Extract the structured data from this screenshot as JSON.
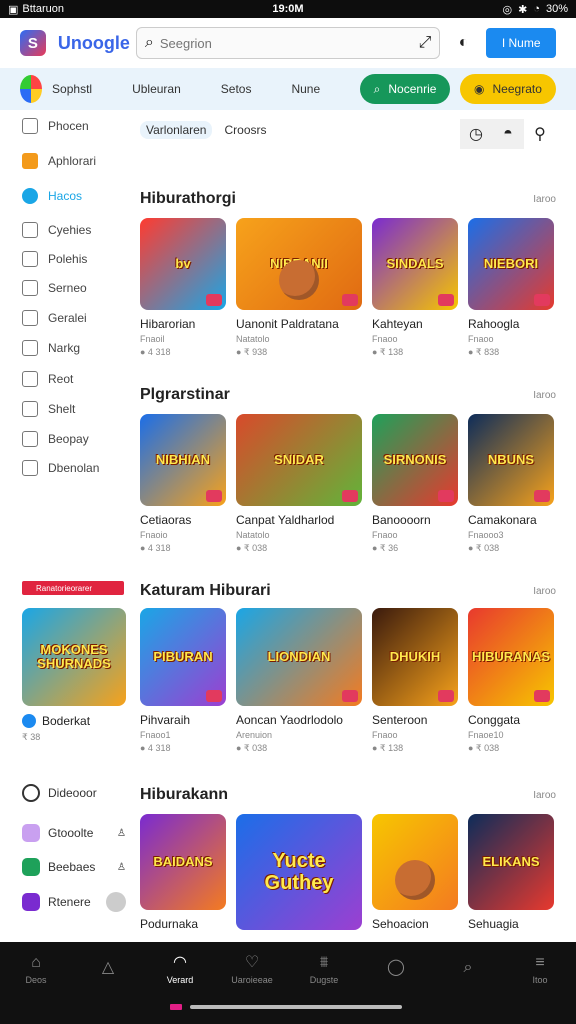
{
  "status": {
    "carrier": "Bttaruon",
    "time": "19:0M",
    "battery": "30%"
  },
  "topbar": {
    "brand": "Unoogle",
    "search_placeholder": "Seegrion",
    "primary_button": "I Nume"
  },
  "catbar": {
    "items": [
      "Sophstl",
      "Ubleuran",
      "Setos",
      "Nune"
    ],
    "green_pill": "Nocenrie",
    "yellow_pill": "Neegrato"
  },
  "sidebar": {
    "items": [
      {
        "label": "Phocen"
      },
      {
        "label": "Aphlorari"
      },
      {
        "label": "Hacos"
      },
      {
        "label": "Cyehies"
      },
      {
        "label": "Polehis"
      },
      {
        "label": "Serneo"
      },
      {
        "label": "Geralei"
      },
      {
        "label": "Narkg"
      },
      {
        "label": "Reot"
      },
      {
        "label": "Shelt"
      },
      {
        "label": "Beopay"
      },
      {
        "label": "Dbenolan"
      }
    ]
  },
  "main_tabs": {
    "tab1": "Varlonlaren",
    "tab2": "Croosrs"
  },
  "sections": [
    {
      "title": "Hiburathorgi",
      "more": "Iaroo",
      "cards": [
        {
          "name": "Hibarorian",
          "sub": "Fnaoil",
          "meta": "● 4 318",
          "art": "bv",
          "colors": [
            "#ff3b30",
            "#1aa6e6"
          ]
        },
        {
          "name": "Uanonit Paldratana",
          "sub": "Natatolo",
          "meta": "● ₹ 938",
          "art": "NIBRANII",
          "colors": [
            "#f7a21b",
            "#e06a12"
          ]
        },
        {
          "name": "Kahteyan",
          "sub": "Fnaoo",
          "meta": "● ₹ 138",
          "art": "SINDALS",
          "colors": [
            "#7a2bd0",
            "#f7c600"
          ]
        },
        {
          "name": "Rahoogla",
          "sub": "Fnaoo",
          "meta": "● ₹ 838",
          "art": "NIEBORI",
          "colors": [
            "#1b6ee8",
            "#e63a2e"
          ]
        }
      ]
    },
    {
      "title": "Plgrarstinar",
      "more": "Iaroo",
      "cards": [
        {
          "name": "Cetiaoras",
          "sub": "Fnaoio",
          "meta": "● 4 318",
          "art": "NIBHIAN",
          "colors": [
            "#1b6ee8",
            "#f7a21b"
          ]
        },
        {
          "name": "Canpat Yaldharlod",
          "sub": "Natatolo",
          "meta": "● ₹ 038",
          "art": "SNIDAR",
          "colors": [
            "#d84a2b",
            "#62b43a"
          ]
        },
        {
          "name": "Banoooorn",
          "sub": "Fnaoo",
          "meta": "● ₹ 36",
          "art": "SIRNONIS",
          "colors": [
            "#1ea15a",
            "#e8392e"
          ]
        },
        {
          "name": "Camakonara",
          "sub": "Fnaooo3",
          "meta": "● ₹ 038",
          "art": "NBUNS",
          "colors": [
            "#0d2c5a",
            "#f7a21b"
          ]
        }
      ]
    },
    {
      "title": "Katuram Hiburari",
      "more": "Iaroo",
      "cards": [
        {
          "name": "Pihvaraih",
          "sub": "Fnaoo1",
          "meta": "● 4 318",
          "art": "PIBURAN",
          "colors": [
            "#1aa6e6",
            "#9c3fd1"
          ]
        },
        {
          "name": "Aoncan Yaodrlodolo",
          "sub": "Arenuion",
          "meta": "● ₹ 038",
          "art": "LIONDIAN",
          "colors": [
            "#1aa6e6",
            "#f47b20"
          ]
        },
        {
          "name": "Senteroon",
          "sub": "Fnaoo",
          "meta": "● ₹ 138",
          "art": "DHUKIH",
          "colors": [
            "#3a1a0d",
            "#f7a21b"
          ]
        },
        {
          "name": "Conggata",
          "sub": "Fnaoe10",
          "meta": "● ₹ 038",
          "art": "HIBURANAS",
          "colors": [
            "#e8392e",
            "#f7c600"
          ]
        }
      ],
      "left_card": {
        "name": "Boderkat",
        "meta": "₹ 38",
        "art": "MOKONES SHURNADS",
        "ad": "Ranatorieorarer"
      }
    },
    {
      "title": "Hiburakann",
      "more": "Iaroo",
      "cards": [
        {
          "name": "Podurnaka",
          "sub": "",
          "meta": "",
          "art": "BAIDANS",
          "colors": [
            "#7a2bd0",
            "#f47b20"
          ]
        },
        {
          "name": "",
          "sub": "",
          "meta": "",
          "art": "Yucte Guthey",
          "colors": [
            "#1b6ee8",
            "#9c3fd1"
          ]
        },
        {
          "name": "Sehoacion",
          "sub": "",
          "meta": "",
          "art": "",
          "colors": [
            "#f7c600",
            "#f47b20"
          ]
        },
        {
          "name": "Sehuagia",
          "sub": "",
          "meta": "",
          "art": "ELIKANS",
          "colors": [
            "#0d2c5a",
            "#e8392e"
          ]
        }
      ]
    }
  ],
  "left_bottom": {
    "header": "Dideooor",
    "items": [
      {
        "label": "Gtooolte"
      },
      {
        "label": "Beebaes"
      },
      {
        "label": "Rtenere"
      }
    ]
  },
  "bottomnav": {
    "items": [
      {
        "label": "Deos"
      },
      {
        "label": ""
      },
      {
        "label": "Verard"
      },
      {
        "label": "Uaroieeae"
      },
      {
        "label": "Dugste"
      },
      {
        "label": ""
      },
      {
        "label": ""
      },
      {
        "label": "Itoo"
      }
    ]
  }
}
